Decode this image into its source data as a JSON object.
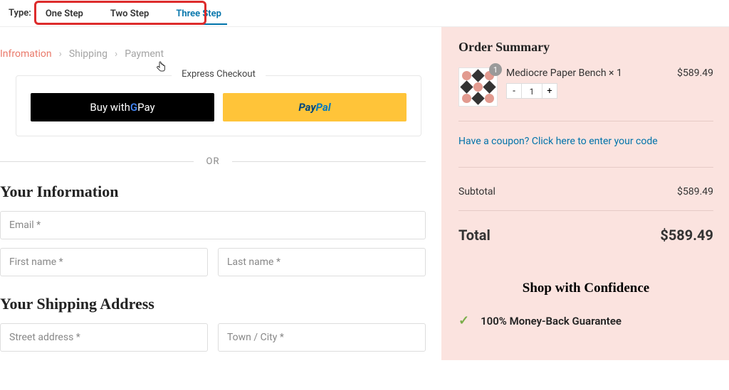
{
  "top": {
    "type_label": "Type:",
    "tabs": [
      "One Step",
      "Two Step",
      "Three Step"
    ],
    "active_index": 2
  },
  "breadcrumb": {
    "steps": [
      "Infromation",
      "Shipping",
      "Payment"
    ],
    "active_index": 0
  },
  "express": {
    "title": "Express Checkout",
    "gpay_prefix": "Buy with ",
    "gpay_suffix": " Pay",
    "paypal_pay": "Pay",
    "paypal_pal": "Pal"
  },
  "or_label": "OR",
  "sections": {
    "info": "Your Information",
    "shipping": "Your Shipping Address"
  },
  "placeholders": {
    "email": "Email *",
    "first": "First name *",
    "last": "Last name *",
    "street": "Street address *",
    "city": "Town / City *"
  },
  "summary": {
    "title": "Order Summary",
    "product": {
      "name": "Mediocre Paper Bench × 1",
      "price": "$589.49",
      "qty": "1",
      "badge": "1"
    },
    "coupon_text": "Have a coupon? Click here to enter your code",
    "subtotal_label": "Subtotal",
    "subtotal_value": "$589.49",
    "total_label": "Total",
    "total_value": "$589.49"
  },
  "confidence": {
    "title": "Shop with Confidence",
    "item": "100% Money-Back Guarantee"
  }
}
